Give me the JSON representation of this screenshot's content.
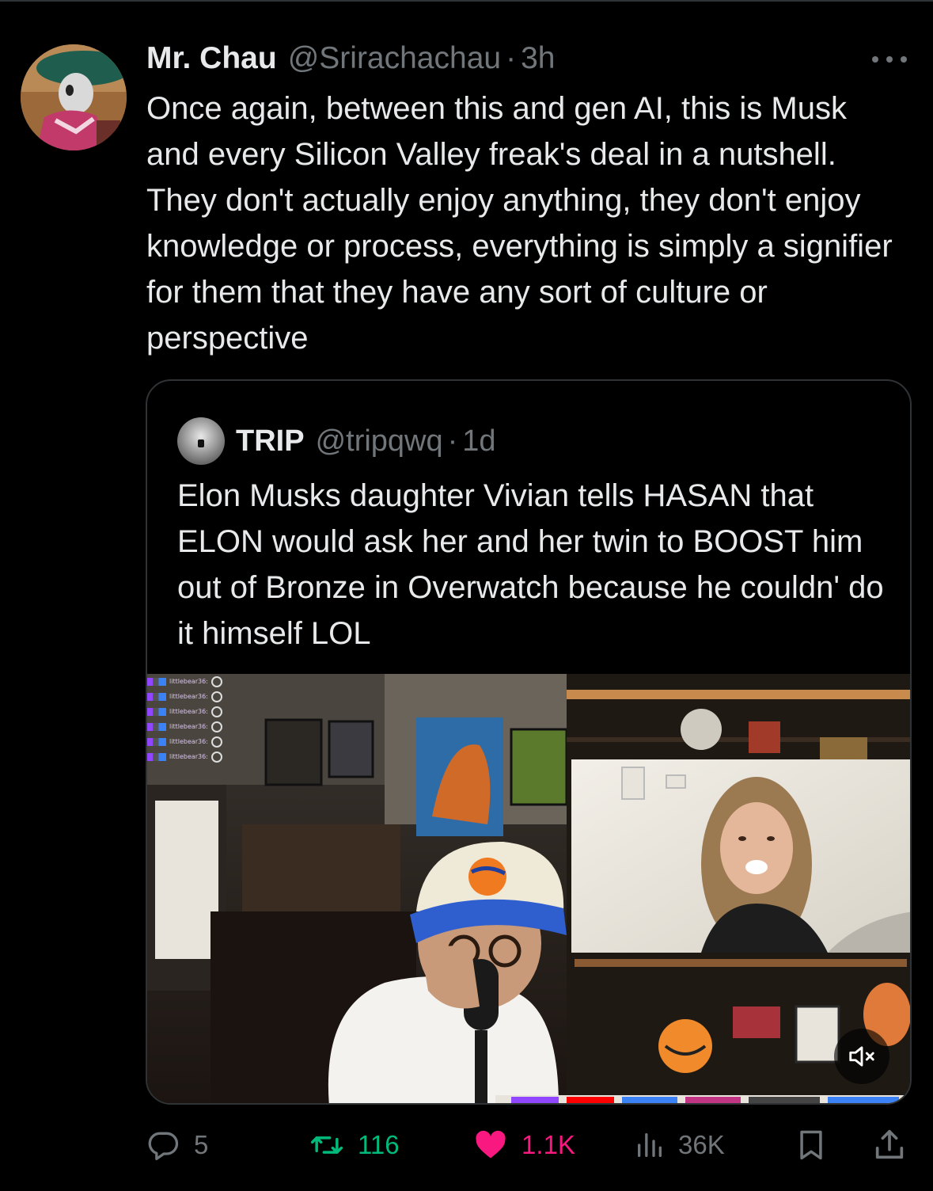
{
  "tweet": {
    "display_name": "Mr. Chau",
    "handle": "@Srirachachau",
    "separator": "·",
    "time": "3h",
    "text": "Once again, between this and gen AI, this is Musk and every Silicon Valley freak's deal in a nutshell. They don't actually enjoy anything, they don't enjoy knowledge or process, everything is simply a signifier for them that they have any sort of culture or perspective"
  },
  "quote": {
    "display_name": "TRIP",
    "handle": "@tripqwq",
    "separator": "·",
    "time": "1d",
    "text": "Elon Musks daughter Vivian tells HASAN that ELON would ask her and her twin to BOOST him out of Bronze in Overwatch because he couldn' do it himself  LOL",
    "video": {
      "chat_name": "littlebear36:",
      "muted": true
    }
  },
  "actions": {
    "replies": "5",
    "reposts": "116",
    "likes": "1.1K",
    "views": "36K"
  },
  "colors": {
    "background": "#000000",
    "text": "#e7e9ea",
    "muted": "#71767b",
    "border": "#2f3336",
    "repost_active": "#00ba7c",
    "like_active": "#f91880"
  },
  "icons": {
    "more": "more-icon",
    "reply": "reply-icon",
    "repost": "repost-icon",
    "like": "heart-icon",
    "views": "views-icon",
    "bookmark": "bookmark-icon",
    "share": "share-icon",
    "mute": "mute-icon"
  }
}
